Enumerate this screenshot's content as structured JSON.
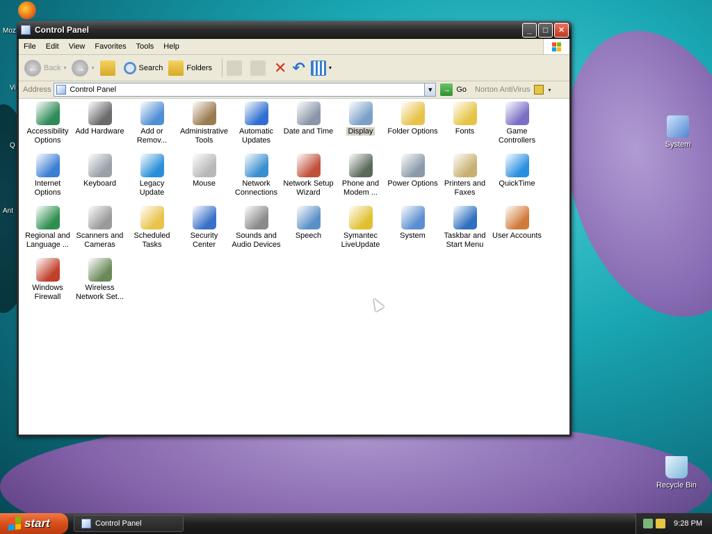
{
  "window": {
    "title": "Control Panel",
    "controls": {
      "minimize": "_",
      "maximize": "□",
      "close": "✕"
    }
  },
  "menu": [
    "File",
    "Edit",
    "View",
    "Favorites",
    "Tools",
    "Help"
  ],
  "toolbar": {
    "back": "Back",
    "search": "Search",
    "folders": "Folders"
  },
  "address": {
    "label": "Address",
    "value": "Control Panel",
    "go": "Go",
    "norton": "Norton AntiVirus"
  },
  "items": [
    {
      "line1": "Accessibility",
      "line2": "Options",
      "icon": "accessibility-icon",
      "color": "#2e8b57"
    },
    {
      "line1": "Add Hardware",
      "line2": "",
      "icon": "add-hardware-icon",
      "color": "#6b6b6b"
    },
    {
      "line1": "Add or",
      "line2": "Remov...",
      "icon": "add-remove-programs-icon",
      "color": "#4f8fd6"
    },
    {
      "line1": "Administrative",
      "line2": "Tools",
      "icon": "administrative-tools-icon",
      "color": "#9a7b4f"
    },
    {
      "line1": "Automatic",
      "line2": "Updates",
      "icon": "automatic-updates-icon",
      "color": "#2f6fd0"
    },
    {
      "line1": "Date and Time",
      "line2": "",
      "icon": "date-time-icon",
      "color": "#8a96a8"
    },
    {
      "line1": "Display",
      "line2": "",
      "icon": "display-icon",
      "color": "#7aa0c8"
    },
    {
      "line1": "Folder Options",
      "line2": "",
      "icon": "folder-options-icon",
      "color": "#e8c24a"
    },
    {
      "line1": "Fonts",
      "line2": "",
      "icon": "fonts-icon",
      "color": "#e6c445"
    },
    {
      "line1": "Game",
      "line2": "Controllers",
      "icon": "game-controllers-icon",
      "color": "#7a6fc4"
    },
    {
      "line1": "Internet",
      "line2": "Options",
      "icon": "internet-options-icon",
      "color": "#3b7fd4"
    },
    {
      "line1": "Keyboard",
      "line2": "",
      "icon": "keyboard-icon",
      "color": "#9aa0a8"
    },
    {
      "line1": "Legacy",
      "line2": "Update",
      "icon": "legacy-update-icon",
      "color": "#2a8fd8"
    },
    {
      "line1": "Mouse",
      "line2": "",
      "icon": "mouse-icon",
      "color": "#b8b8b8"
    },
    {
      "line1": "Network",
      "line2": "Connections",
      "icon": "network-connections-icon",
      "color": "#3a8fd0"
    },
    {
      "line1": "Network Setup",
      "line2": "Wizard",
      "icon": "network-setup-wizard-icon",
      "color": "#c0503a"
    },
    {
      "line1": "Phone and",
      "line2": "Modem ...",
      "icon": "phone-modem-icon",
      "color": "#5a6a5a"
    },
    {
      "line1": "Power Options",
      "line2": "",
      "icon": "power-options-icon",
      "color": "#8a9aa8"
    },
    {
      "line1": "Printers and",
      "line2": "Faxes",
      "icon": "printers-faxes-icon",
      "color": "#c8b070"
    },
    {
      "line1": "QuickTime",
      "line2": "",
      "icon": "quicktime-icon",
      "color": "#2a8fe0"
    },
    {
      "line1": "Regional and",
      "line2": "Language ...",
      "icon": "regional-language-icon",
      "color": "#2f8f4f"
    },
    {
      "line1": "Scanners and",
      "line2": "Cameras",
      "icon": "scanners-cameras-icon",
      "color": "#9a9a9a"
    },
    {
      "line1": "Scheduled",
      "line2": "Tasks",
      "icon": "scheduled-tasks-icon",
      "color": "#e8c24a"
    },
    {
      "line1": "Security",
      "line2": "Center",
      "icon": "security-center-icon",
      "color": "#3a70c8"
    },
    {
      "line1": "Sounds and",
      "line2": "Audio Devices",
      "icon": "sounds-audio-icon",
      "color": "#8a8a8a"
    },
    {
      "line1": "Speech",
      "line2": "",
      "icon": "speech-icon",
      "color": "#5a90c8"
    },
    {
      "line1": "Symantec",
      "line2": "LiveUpdate",
      "icon": "symantec-liveupdate-icon",
      "color": "#e0c030"
    },
    {
      "line1": "System",
      "line2": "",
      "icon": "system-icon",
      "color": "#5a8fd0"
    },
    {
      "line1": "Taskbar and",
      "line2": "Start Menu",
      "icon": "taskbar-start-menu-icon",
      "color": "#2f6fc0"
    },
    {
      "line1": "User Accounts",
      "line2": "",
      "icon": "user-accounts-icon",
      "color": "#d07a3a"
    },
    {
      "line1": "Windows",
      "line2": "Firewall",
      "icon": "windows-firewall-icon",
      "color": "#c0402a"
    },
    {
      "line1": "Wireless",
      "line2": "Network Set...",
      "icon": "wireless-network-icon",
      "color": "#6a8a5a"
    }
  ],
  "selected_item": "Display",
  "desktop": {
    "system": "System",
    "recycle": "Recycle Bin",
    "left_labels": [
      "Moz",
      "Vi",
      "Q",
      "Ant"
    ]
  },
  "taskbar": {
    "start": "start",
    "task": "Control Panel",
    "clock": "9:28 PM"
  }
}
